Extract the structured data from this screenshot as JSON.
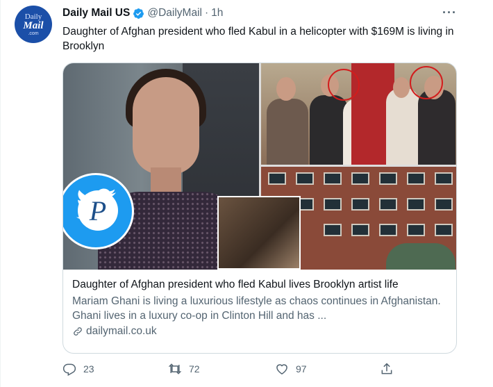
{
  "tweet": {
    "avatar": {
      "line1": "Daily",
      "line2": "Mail",
      "line3": ".com"
    },
    "display_name": "Daily Mail US",
    "handle": "@DailyMail",
    "separator": "·",
    "time": "1h",
    "more": "···",
    "text": "Daughter of Afghan president who fled Kabul in a helicopter with $169M is living in Brooklyn"
  },
  "card": {
    "title": "Daughter of Afghan president who fled Kabul lives Brooklyn artist life",
    "description": "Mariam Ghani is living a luxurious lifestyle as chaos continues in Afghanistan. Ghani lives in a luxury co-op in Clinton Hill and has ...",
    "domain": "dailymail.co.uk",
    "badge_letter": "P"
  },
  "actions": {
    "replies": "23",
    "retweets": "72",
    "likes": "97"
  },
  "colors": {
    "accent": "#1d9bf0",
    "verified": "#1d9bf0",
    "secondary_text": "#536471"
  }
}
